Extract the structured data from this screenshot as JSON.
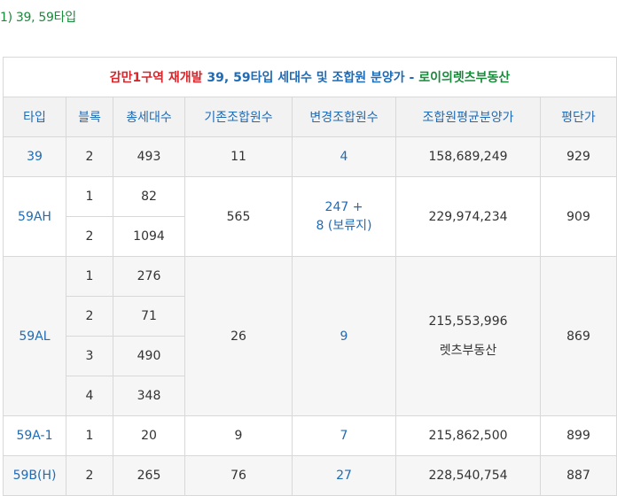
{
  "heading": "1) 39, 59타입",
  "title": {
    "part1": "감만1구역 재개발",
    "part2": "39, 59타입 세대수 및 조합원 분양가 -",
    "part3": "로이의렛츠부동산"
  },
  "headers": [
    "타입",
    "블록",
    "총세대수",
    "기존조합원수",
    "변경조합원수",
    "조합원평균분양가",
    "평단가"
  ],
  "rows": {
    "r39": {
      "type": "39",
      "block": "2",
      "households": "493",
      "orig_members": "11",
      "changed_members": "4",
      "avg_price": "158,689,249",
      "pyeong_price": "929"
    },
    "r59ah": {
      "type": "59AH",
      "blocks": [
        {
          "block": "1",
          "households": "82"
        },
        {
          "block": "2",
          "households": "1094"
        }
      ],
      "orig_members": "565",
      "changed_members_line1": "247 +",
      "changed_members_line2": "8 (보류지)",
      "avg_price": "229,974,234",
      "pyeong_price": "909"
    },
    "r59al": {
      "type": "59AL",
      "blocks": [
        {
          "block": "1",
          "households": "276"
        },
        {
          "block": "2",
          "households": "71"
        },
        {
          "block": "3",
          "households": "490"
        },
        {
          "block": "4",
          "households": "348"
        }
      ],
      "orig_members": "26",
      "changed_members": "9",
      "avg_price": "215,553,996",
      "watermark": "렛츠부동산",
      "pyeong_price": "869"
    },
    "r59a1": {
      "type": "59A-1",
      "block": "1",
      "households": "20",
      "orig_members": "9",
      "changed_members": "7",
      "avg_price": "215,862,500",
      "pyeong_price": "899"
    },
    "r59bh": {
      "type": "59B(H)",
      "block": "2",
      "households": "265",
      "orig_members": "76",
      "changed_members": "27",
      "avg_price": "228,540,754",
      "pyeong_price": "887"
    }
  },
  "colors": {
    "blue": "#1f6bb5",
    "red": "#d8252a",
    "green": "#1a8a3c",
    "header_bg": "#f2f2f2"
  }
}
